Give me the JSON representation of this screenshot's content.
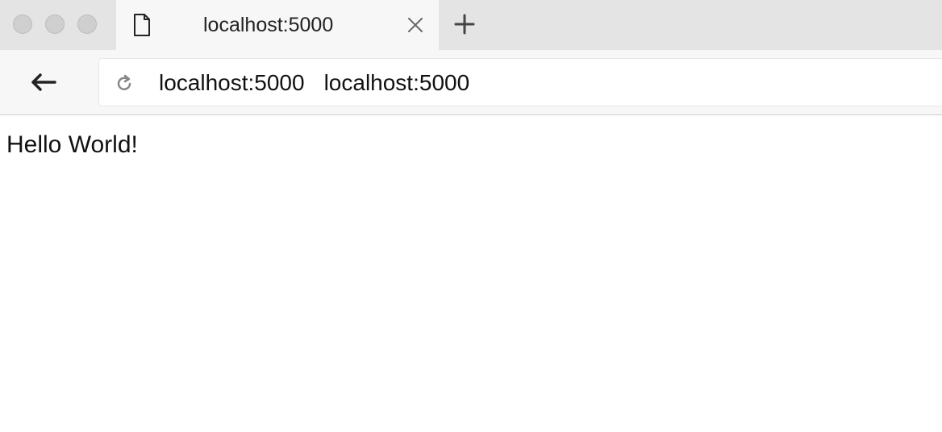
{
  "window": {
    "controls": [
      "close-dot",
      "minimize-dot",
      "maximize-dot"
    ]
  },
  "tab": {
    "title": "localhost:5000",
    "icon": "page-icon",
    "close_icon": "close-icon"
  },
  "new_tab_icon": "plus-icon",
  "toolbar": {
    "back_icon": "arrow-left-icon",
    "reload_icon": "reload-icon",
    "url_host": "localhost:5000",
    "url_title": "localhost:5000"
  },
  "page": {
    "body_text": "Hello World!"
  }
}
